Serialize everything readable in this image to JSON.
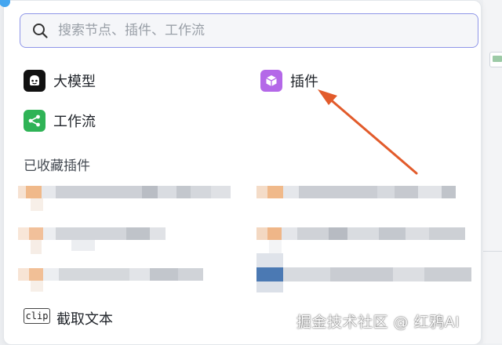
{
  "search": {
    "placeholder": "搜索节点、插件、工作流"
  },
  "menu": {
    "items": [
      {
        "label": "大模型",
        "icon": "bot-face-icon"
      },
      {
        "label": "插件",
        "icon": "cube-icon"
      },
      {
        "label": "工作流",
        "icon": "workflow-icon"
      }
    ]
  },
  "favorites": {
    "title": "已收藏插件"
  },
  "clip_tool": {
    "icon_text": "clip",
    "label": "截取文本"
  },
  "watermark": "掘金技术社区 @ 红鸦AI",
  "colors": {
    "accent": "#8f96e8",
    "plugin_icon": "#b468e8",
    "workflow_icon": "#2fb356",
    "model_icon": "#111111",
    "arrow": "#e25b2b"
  }
}
